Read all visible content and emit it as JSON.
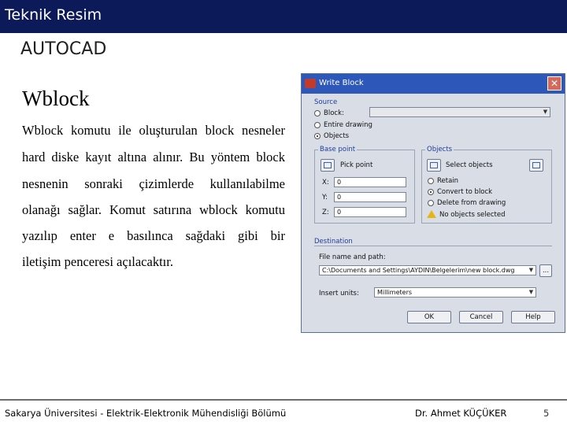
{
  "header": {
    "title": "Teknik Resim",
    "subtitle": "AUTOCAD"
  },
  "content": {
    "heading": "Wblock",
    "lines": [
      "Wblock komutu ile oluşturulan block nesneler",
      "hard diske kayıt altına alınır. Bu yöntem block",
      "nesnenin sonraki çizimlerde kullanılabilme",
      "olanağı sağlar. Komut satırına wblock komutu",
      "yazılıp enter e basılınca sağdaki gibi bir",
      "iletişim penceresi açılacaktır."
    ]
  },
  "dialog": {
    "title": "Write Block",
    "source": {
      "label": "Source",
      "options": [
        "Block:",
        "Entire drawing",
        "Objects"
      ],
      "selected": "Objects"
    },
    "base_point": {
      "label": "Base point",
      "pick_label": "Pick point",
      "x_label": "X:",
      "y_label": "Y:",
      "z_label": "Z:",
      "x": "0",
      "y": "0",
      "z": "0"
    },
    "objects": {
      "label": "Objects",
      "select_label": "Select objects",
      "options": [
        "Retain",
        "Convert to block",
        "Delete from drawing"
      ],
      "selected": "Convert to block",
      "status": "No objects selected"
    },
    "destination": {
      "label": "Destination",
      "file_label": "File name and path:",
      "file_value": "C:\\Documents and Settings\\AYDIN\\Belgelerim\\new block.dwg",
      "browse_label": "...",
      "units_label": "Insert units:",
      "units_value": "Millimeters"
    },
    "buttons": {
      "ok": "OK",
      "cancel": "Cancel",
      "help": "Help"
    }
  },
  "footer": {
    "left": "Sakarya Üniversitesi - Elektrik-Elektronik Mühendisliği Bölümü",
    "author": "Dr. Ahmet KÜÇÜKER",
    "page": "5"
  },
  "colors": {
    "topbar": "#0d1a5a",
    "dialog_titlebar": "#2d57b8"
  }
}
